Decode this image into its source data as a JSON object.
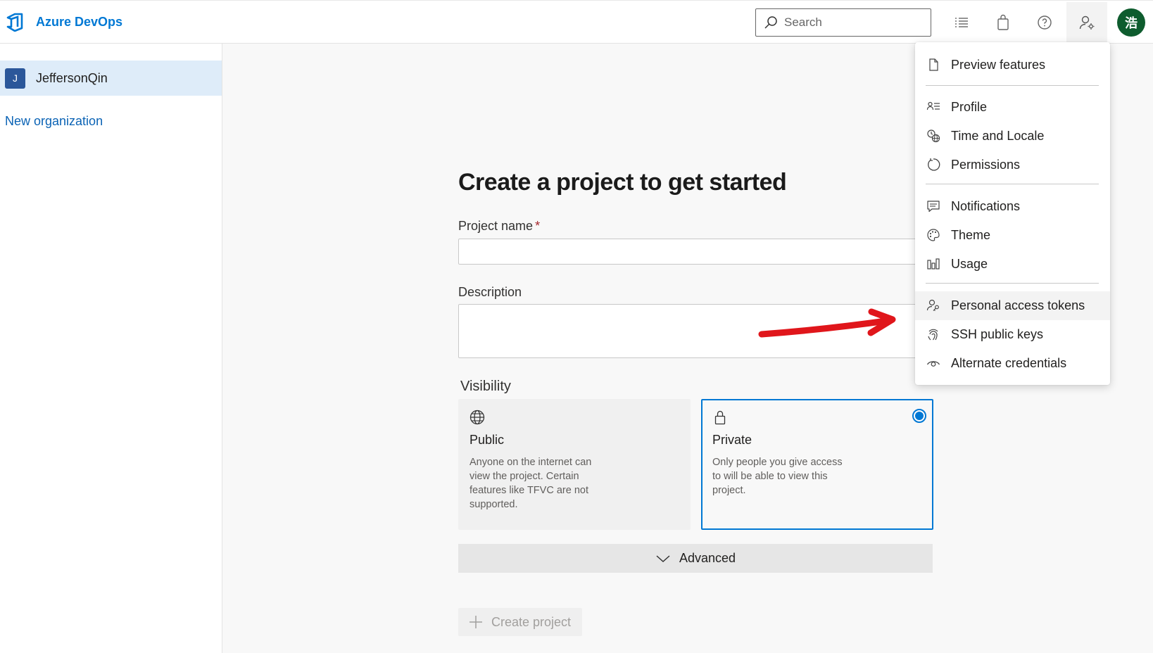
{
  "header": {
    "brand": "Azure DevOps",
    "search_placeholder": "Search",
    "avatar_char": "浩"
  },
  "sidebar": {
    "org": {
      "badge": "J",
      "name": "JeffersonQin"
    },
    "new_org_label": "New organization"
  },
  "main": {
    "title": "Create a project to get started",
    "project_name_label": "Project name",
    "required_marker": "*",
    "description_label": "Description",
    "visibility_label": "Visibility",
    "visibility_options": [
      {
        "title": "Public",
        "desc": "Anyone on the internet can view the project. Certain features like TFVC are not supported."
      },
      {
        "title": "Private",
        "desc": "Only people you give access to will be able to view this project."
      }
    ],
    "selected_visibility": "Private",
    "advanced_label": "Advanced",
    "create_label": "Create project"
  },
  "user_menu": {
    "items": [
      {
        "label": "Preview features",
        "icon": "document-icon"
      },
      {
        "label": "Profile",
        "icon": "profile-icon"
      },
      {
        "label": "Time and Locale",
        "icon": "globe-clock-icon"
      },
      {
        "label": "Permissions",
        "icon": "refresh-circle-icon"
      },
      {
        "label": "Notifications",
        "icon": "chat-icon"
      },
      {
        "label": "Theme",
        "icon": "palette-icon"
      },
      {
        "label": "Usage",
        "icon": "bar-chart-icon"
      },
      {
        "label": "Personal access tokens",
        "icon": "person-key-icon"
      },
      {
        "label": "SSH public keys",
        "icon": "fingerprint-icon"
      },
      {
        "label": "Alternate credentials",
        "icon": "eye-icon"
      }
    ],
    "highlighted": "Personal access tokens"
  },
  "colors": {
    "accent": "#0078d4",
    "avatar_bg": "#0e5c2e",
    "annotation": "#e0161b"
  }
}
